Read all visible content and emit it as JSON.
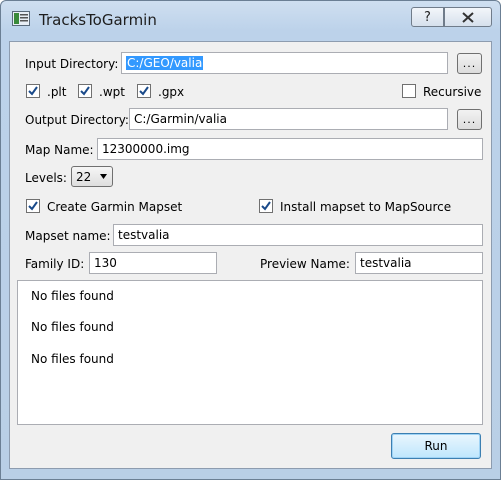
{
  "window": {
    "title": "TracksToGarmin",
    "help_glyph": "?",
    "close_glyph": "X"
  },
  "input_directory": {
    "label": "Input Directory:",
    "value": "C:/GEO/valia",
    "browse_label": "..."
  },
  "filters": {
    "plt": ".plt",
    "wpt": ".wpt",
    "gpx": ".gpx",
    "recursive": "Recursive",
    "plt_checked": true,
    "wpt_checked": true,
    "gpx_checked": true,
    "recursive_checked": false
  },
  "output_directory": {
    "label": "Output Directory:",
    "value": "C:/Garmin/valia",
    "browse_label": "..."
  },
  "map_name": {
    "label": "Map Name:",
    "value": "12300000.img"
  },
  "levels": {
    "label": "Levels:",
    "value": "22"
  },
  "options": {
    "create_mapset": "Create Garmin Mapset",
    "install_mapset": "Install mapset to MapSource",
    "create_checked": true,
    "install_checked": true
  },
  "mapset_name": {
    "label": "Mapset name:",
    "value": "testvalia"
  },
  "family_id": {
    "label": "Family ID:",
    "value": "130"
  },
  "preview_name": {
    "label": "Preview Name:",
    "value": "testvalia"
  },
  "log": {
    "lines": [
      "No files found",
      "No files found",
      "No files found"
    ]
  },
  "run_button": {
    "label": "Run"
  }
}
